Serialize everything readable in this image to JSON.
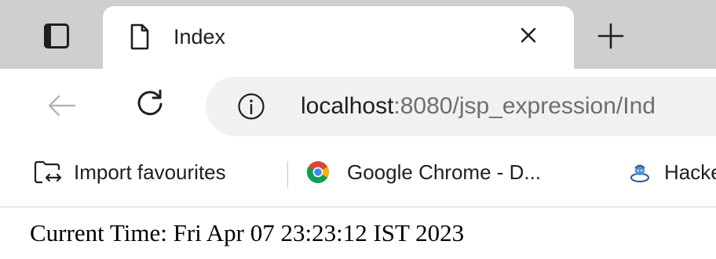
{
  "tab": {
    "title": "Index"
  },
  "address_bar": {
    "host": "localhost",
    "path": ":8080/jsp_expression/Ind"
  },
  "favourites": {
    "items": [
      {
        "label": "Import favourites",
        "icon": "import-favourites-icon"
      },
      {
        "label": "Google Chrome - D...",
        "icon": "chrome-icon"
      },
      {
        "label": "Hacke",
        "icon": "hacker-icon"
      }
    ]
  },
  "page": {
    "time_label": "Current Time: Fri Apr 07 23:23:12 IST 2023"
  },
  "colors": {
    "tab_strip": "#cfcfcf",
    "address_bar_bg": "#f1f1f1",
    "text": "#1f1f1f",
    "url_muted": "#6e6e6e"
  }
}
